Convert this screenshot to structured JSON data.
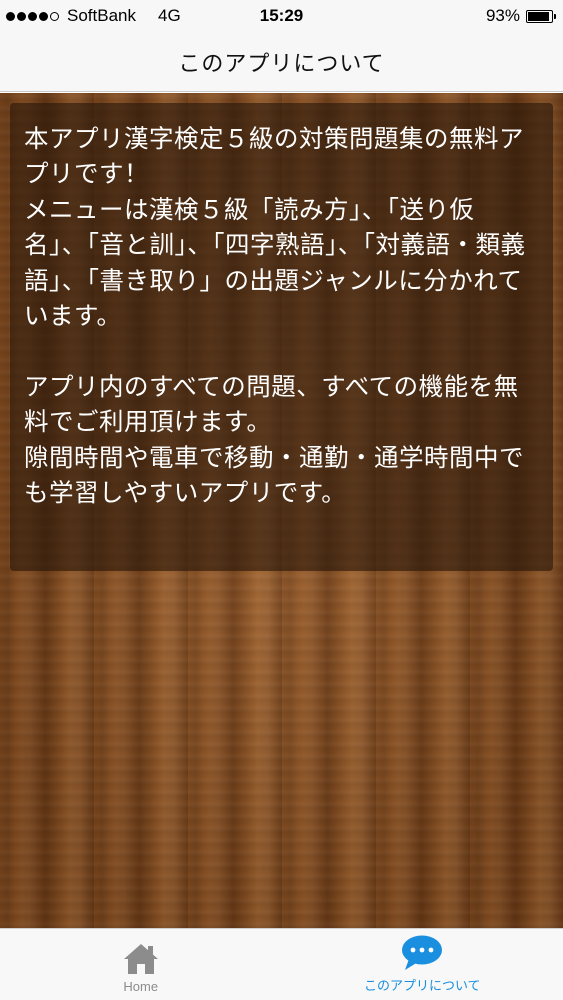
{
  "status_bar": {
    "signal_bars_filled": 4,
    "signal_bars_total": 5,
    "carrier": "SoftBank",
    "network": "4G",
    "time": "15:29",
    "battery_percent": "93%",
    "battery_level": 0.93
  },
  "nav": {
    "title": "このアプリについて"
  },
  "content": {
    "text": "本アプリ漢字検定５級の対策問題集の無料アプリです！\nメニューは漢検５級「読み方」、「送り仮名」、「音と訓」、「四字熟語」、「対義語・類義語」、「書き取り」の出題ジャンルに分かれています。\n\nアプリ内のすべての問題、すべての機能を無料でご利用頂けます。\n隙間時間や電車で移動・通勤・通学時間中でも学習しやすいアプリです。"
  },
  "tab_bar": {
    "tabs": [
      {
        "label": "Home",
        "icon": "house-icon",
        "active": false
      },
      {
        "label": "このアプリについて",
        "icon": "speech-bubble-icon",
        "active": true
      }
    ],
    "active_color": "#1a8fe0",
    "inactive_color": "#8c8c8c"
  }
}
